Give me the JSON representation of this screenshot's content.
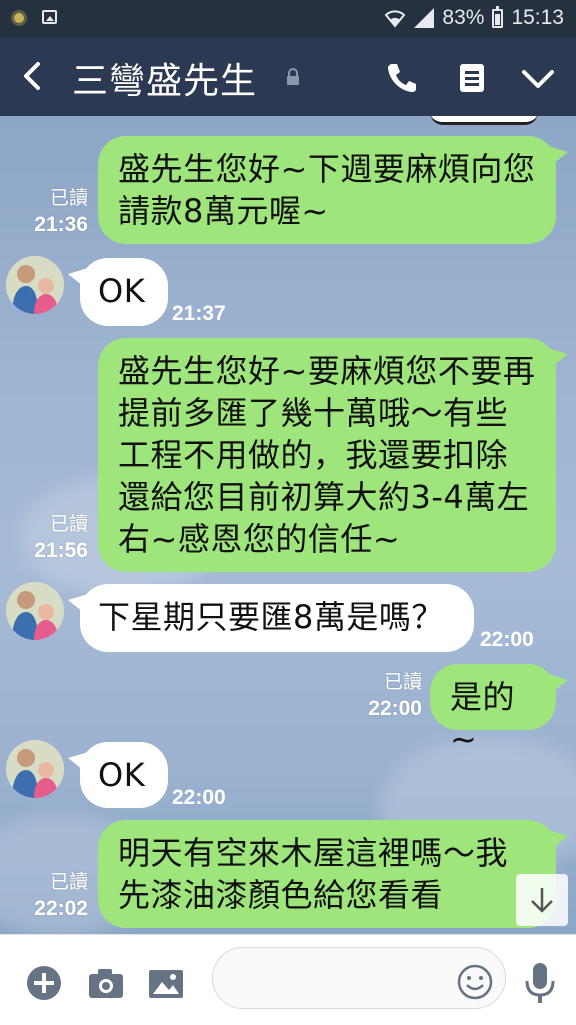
{
  "status_bar": {
    "battery": "83%",
    "time": "15:13"
  },
  "header": {
    "title": "三彎盛先生"
  },
  "messages": [
    {
      "side": "out",
      "text": "盛先生您好~下週要麻煩向您請款8萬元喔~",
      "read": "已讀",
      "time": "21:36"
    },
    {
      "side": "in",
      "text": "OK",
      "time": "21:37"
    },
    {
      "side": "out",
      "text": "盛先生您好~要麻煩您不要再提前多匯了幾十萬哦～有些工程不用做的，我還要扣除還給您目前初算大約3-4萬左右~感恩您的信任~",
      "read": "已讀",
      "time": "21:56"
    },
    {
      "side": "in",
      "text": "下星期只要匯8萬是嗎？",
      "time": "22:00"
    },
    {
      "side": "out",
      "text": "是的~",
      "read": "已讀",
      "time": "22:00"
    },
    {
      "side": "in",
      "text": "OK",
      "time": "22:00"
    },
    {
      "side": "out",
      "text": "明天有空來木屋這裡嗎～我先漆油漆顏色給您看看",
      "read": "已讀",
      "time": "22:02"
    }
  ],
  "input": {
    "value": "",
    "placeholder": ""
  },
  "icons": {
    "back": "chevron-left-icon",
    "lock": "lock-icon",
    "call": "phone-icon",
    "notes": "note-icon",
    "menu": "chevron-down-icon",
    "add": "plus-circle-icon",
    "camera": "camera-icon",
    "gallery": "image-icon",
    "emoji": "smiley-icon",
    "mic": "microphone-icon",
    "scroll": "arrow-down-icon"
  },
  "colors": {
    "header_bg": "#2b3a52",
    "outgoing_bubble": "#9ee57c",
    "incoming_bubble": "#ffffff",
    "chat_bg": "#9fb5d1"
  }
}
